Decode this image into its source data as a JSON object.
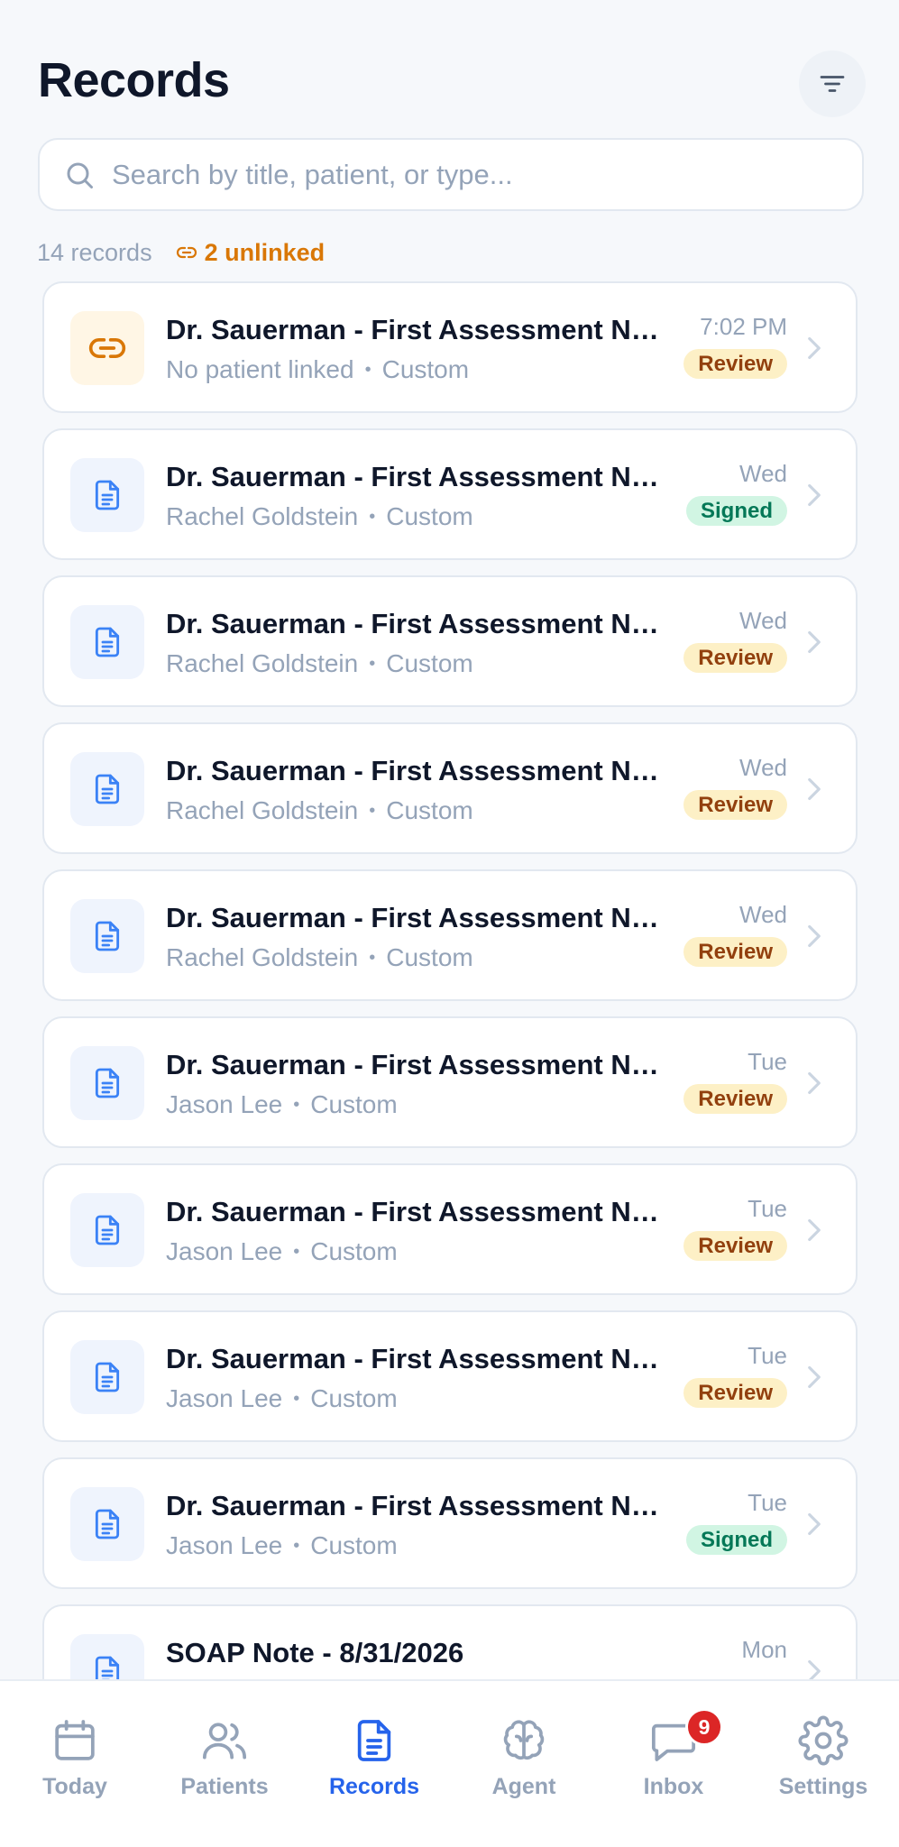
{
  "header": {
    "title": "Records"
  },
  "search": {
    "placeholder": "Search by title, patient, or type..."
  },
  "summary": {
    "count": "14 records",
    "unlinked": "2 unlinked"
  },
  "records": [
    {
      "title": "Dr. Sauerman - First Assessment Note",
      "patient": "No patient linked",
      "type": "Custom",
      "time": "7:02 PM",
      "status": "Review",
      "linked": false
    },
    {
      "title": "Dr. Sauerman - First Assessment Note",
      "patient": "Rachel Goldstein",
      "type": "Custom",
      "time": "Wed",
      "status": "Signed",
      "linked": true
    },
    {
      "title": "Dr. Sauerman - First Assessment Note",
      "patient": "Rachel Goldstein",
      "type": "Custom",
      "time": "Wed",
      "status": "Review",
      "linked": true
    },
    {
      "title": "Dr. Sauerman - First Assessment Note",
      "patient": "Rachel Goldstein",
      "type": "Custom",
      "time": "Wed",
      "status": "Review",
      "linked": true
    },
    {
      "title": "Dr. Sauerman - First Assessment Note",
      "patient": "Rachel Goldstein",
      "type": "Custom",
      "time": "Wed",
      "status": "Review",
      "linked": true
    },
    {
      "title": "Dr. Sauerman - First Assessment Note",
      "patient": "Jason Lee",
      "type": "Custom",
      "time": "Tue",
      "status": "Review",
      "linked": true
    },
    {
      "title": "Dr. Sauerman - First Assessment Note",
      "patient": "Jason Lee",
      "type": "Custom",
      "time": "Tue",
      "status": "Review",
      "linked": true
    },
    {
      "title": "Dr. Sauerman - First Assessment Note",
      "patient": "Jason Lee",
      "type": "Custom",
      "time": "Tue",
      "status": "Review",
      "linked": true
    },
    {
      "title": "Dr. Sauerman - First Assessment Note",
      "patient": "Jason Lee",
      "type": "Custom",
      "time": "Tue",
      "status": "Signed",
      "linked": true
    },
    {
      "title": "SOAP Note - 8/31/2026",
      "patient": "",
      "type": "",
      "time": "Mon",
      "status": "",
      "linked": true
    }
  ],
  "tabs": [
    {
      "id": "today",
      "label": "Today",
      "icon": "calendar-icon",
      "active": false
    },
    {
      "id": "patients",
      "label": "Patients",
      "icon": "users-icon",
      "active": false
    },
    {
      "id": "records",
      "label": "Records",
      "icon": "document-icon",
      "active": true
    },
    {
      "id": "agent",
      "label": "Agent",
      "icon": "brain-icon",
      "active": false
    },
    {
      "id": "inbox",
      "label": "Inbox",
      "icon": "message-icon",
      "active": false,
      "badge": "9"
    },
    {
      "id": "settings",
      "label": "Settings",
      "icon": "gear-icon",
      "active": false
    }
  ],
  "colors": {
    "accent": "#2563EB",
    "warning": "#D97706",
    "review_bg": "#FDF0C6",
    "review_text": "#92400E",
    "signed_bg": "#D1F5E3",
    "signed_text": "#047857",
    "muted": "#94A3B8",
    "badge_red": "#DC2626"
  }
}
